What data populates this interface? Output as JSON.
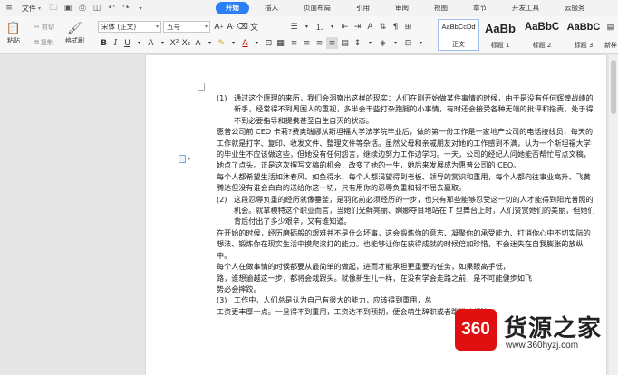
{
  "menubar": {
    "file_label": "文件",
    "tabs": [
      {
        "label": "开始",
        "active": true
      },
      {
        "label": "插入",
        "active": false
      },
      {
        "label": "页面布局",
        "active": false
      },
      {
        "label": "引用",
        "active": false
      },
      {
        "label": "审阅",
        "active": false
      },
      {
        "label": "视图",
        "active": false
      },
      {
        "label": "章节",
        "active": false
      },
      {
        "label": "开发工具",
        "active": false
      },
      {
        "label": "云服务",
        "active": false
      }
    ]
  },
  "ribbon": {
    "paste_label": "粘贴",
    "cut_label": "剪切",
    "copy_label": "复制",
    "format_painter_label": "格式刷",
    "font_name": "宋体 (正文)",
    "font_size": "五号",
    "styles": [
      {
        "preview": "AaBbCcDd",
        "name": "正文"
      },
      {
        "preview": "AaBb",
        "name": "标题 1"
      },
      {
        "preview": "AaBbC",
        "name": "标题 2"
      },
      {
        "preview": "AaBbC",
        "name": "标题 3"
      },
      {
        "preview": "",
        "name": "新样"
      }
    ]
  },
  "document": {
    "p1_num": "(1)",
    "p1": "通过这个原理的来历，我们会洞察出这样的现实：人们在刚开始做某件事情的时候，由于是没有任何辉煌战绩的新手，经常得不到周围人的重视，多半会干些打杂跑腿的小事情，有时还会接受各种无端的批评和指责，处于得不到必要指导和提携甚至自生自灭的状态。",
    "p2": "惠普公司前 CEO 卡莉?费奥瑞娜从斯坦福大学法学院毕业后，做的第一份工作是一家地产公司的电话接线员，每天的工作就是打字、复印、收发文件、整理文件等杂活。虽然父母和亲戚朋友对她的工作感到不满，认为一个斯坦福大学的毕业生不应该做这些，但她没有任何怨言，继续边努力工作边学习。一天，公司的经纪人问她能否帮忙写点文稿，她点了点头。正是这次撰写文稿的机会，改变了她的一生，她后来发展成为惠普公司的 CEO。",
    "p3": "每个人都希望生活如沐春风、如鱼得水，每个人都渴望得到老板、领导的赏识和重用，每个人都向往事业高升、飞黄腾达但没有谁会白白的送给你这一切，只有用你的忍辱负重和韧不屈去赢取。",
    "p4_num": "(2)",
    "p4": "这段忍辱负重的经历就像垂釜，是羽化前必须经历的一步，也只有那些能够忍受这一切的人才能得到阳光普照的机会。就拿模特这个职业而言，当她们光鲜亮丽、婀娜夺目地站在 T 型舞台上时，人们赞赏她们的美丽，但她们背后付出了多少艰辛，又有谁知道。",
    "p5": "在开始的时候，经历磨砺般的艰难并不是什么坏事，这会锻炼你的意志、凝聚你的承受能力、打消你心中不切实际的想法、锻炼你在现实生活中摸爬滚打的能力。也能够让你在获得成就的时候倍加珍惜，不会迷失在自我膨胀的放纵中。",
    "p6": "每个人在做事情的时候都要从最简单的做起，进而才能承担更重要的任务，如果眼高手低，",
    "p6b": "路，谁想逾越这一步，都将会栽跟头。就像新生儿一样，在没有学会走路之前，是不可能健步如飞",
    "p6c": "势必会摔跤。",
    "p7_num": "(3)",
    "p7": "工作中，人们总是认为自己有很大的能力，应该得到重用，总",
    "p7b": "工资更丰厚一点。一旦得不到重用，工资达不到预期，便会萌生辞职或者跳槽的想法。"
  },
  "watermark": {
    "badge": "360",
    "title": "货源之家",
    "url": "www.360hyzj.com"
  },
  "colors": {
    "accent": "#2b7ff5",
    "watermark_red": "#e01010"
  }
}
